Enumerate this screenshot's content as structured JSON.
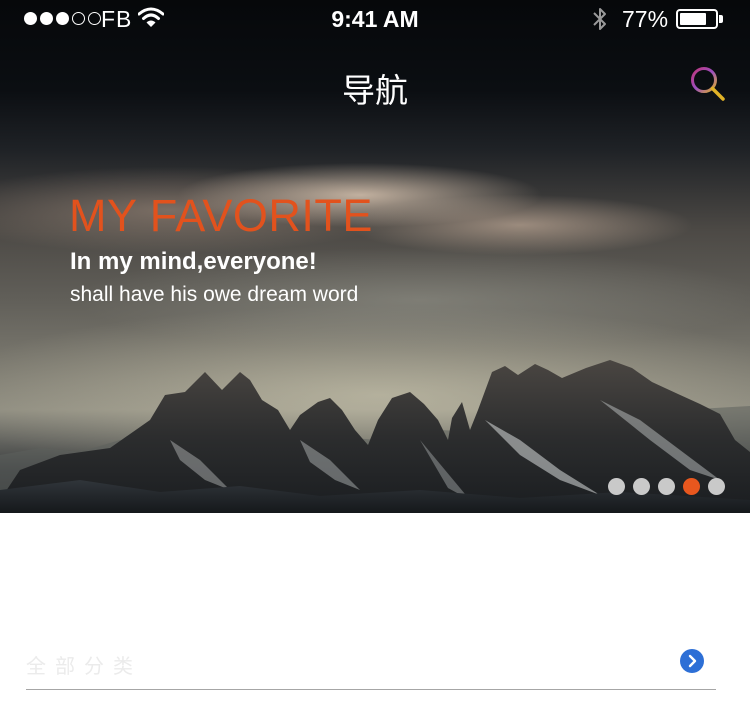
{
  "status_bar": {
    "signal_dots": [
      true,
      true,
      true,
      false,
      false
    ],
    "carrier": "FB",
    "time": "9:41 AM",
    "battery_percent": "77%",
    "battery_level": 0.77
  },
  "nav": {
    "title": "导航",
    "search_icon": "search-icon"
  },
  "banner": {
    "headline": "MY FAVORITE",
    "subheadline": "In my mind,everyone!",
    "body": "shall have his owe dream word",
    "page_count": 5,
    "active_page": 4,
    "colors": {
      "headline": "#e2521d",
      "active_dot": "#e8571e",
      "inactive_dot": "#c9c9c9"
    }
  },
  "category": {
    "label": "全部分类",
    "arrow_icon": "chevron-right-icon",
    "arrow_color": "#2d6fd6"
  }
}
